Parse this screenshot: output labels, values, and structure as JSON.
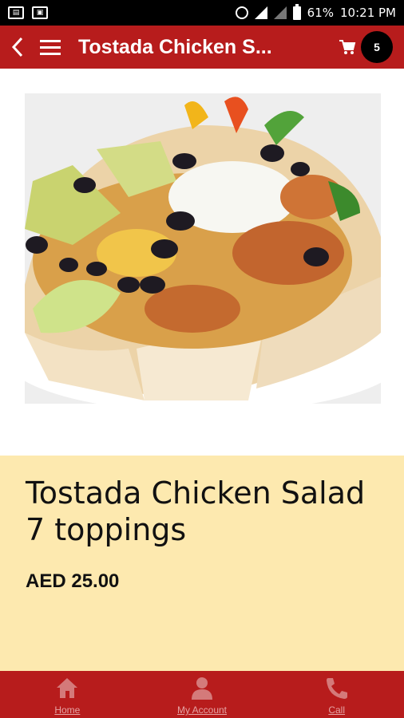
{
  "status_bar": {
    "left_icons": [
      "sim-icon",
      "image-icon"
    ],
    "battery_percent": "61%",
    "time": "10:21 PM"
  },
  "app_bar": {
    "title": "Tostada Chicken S...",
    "cart_count": "5"
  },
  "product": {
    "name": "Tostada Chicken Salad 7 toppings",
    "price": "AED 25.00",
    "image_alt": "tostada-chicken-salad-photo"
  },
  "bottom_nav": {
    "items": [
      {
        "label": "Home",
        "icon": "home-icon"
      },
      {
        "label": "My Account",
        "icon": "account-icon"
      },
      {
        "label": "Call",
        "icon": "phone-icon"
      }
    ]
  },
  "colors": {
    "primary": "#b71c1c",
    "info_background": "#fde9af",
    "badge": "#000000"
  }
}
